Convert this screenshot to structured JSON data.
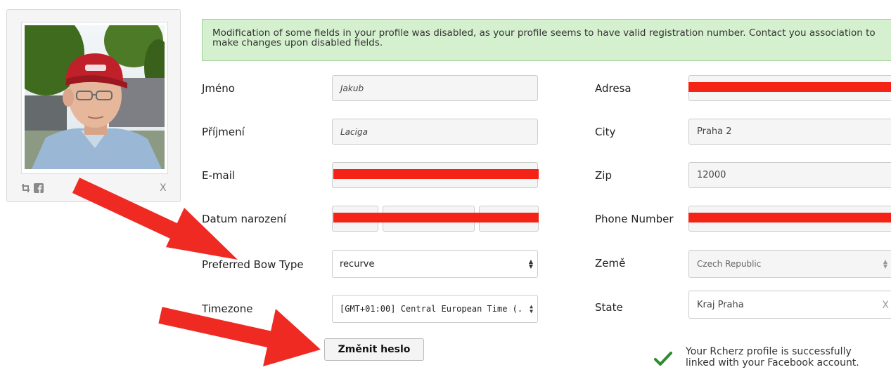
{
  "profile_card": {
    "icons": [
      "crop-icon",
      "facebook-icon",
      "remove-x-icon"
    ],
    "remove_label": "X"
  },
  "notice": {
    "text": "Modification of some fields in your profile was disabled, as your profile seems to have valid registration number. Contact you association to make changes upon disabled fields."
  },
  "left_form": {
    "first_name": {
      "label": "Jméno",
      "value": "Jakub"
    },
    "last_name": {
      "label": "Příjmení",
      "value": "Laciga"
    },
    "email": {
      "label": "E-mail",
      "value": ""
    },
    "birth_date": {
      "label": "Datum narození"
    },
    "bow_type": {
      "label": "Preferred Bow Type",
      "value": "recurve"
    },
    "timezone": {
      "label": "Timezone",
      "value": "[GMT+01:00] Central European Time (."
    }
  },
  "right_form": {
    "address": {
      "label": "Adresa",
      "value": ""
    },
    "city": {
      "label": "City",
      "value": "Praha 2"
    },
    "zip": {
      "label": "Zip",
      "value": "12000"
    },
    "phone": {
      "label": "Phone Number",
      "value": ""
    },
    "country": {
      "label": "Země",
      "value": "Czech Republic"
    },
    "state": {
      "label": "State",
      "value": "Kraj Praha",
      "clear_label": "X"
    }
  },
  "change_password_button": "Změnit heslo",
  "facebook_status": {
    "line1": "Your Rcherz profile is successfully",
    "line2": "linked with your Facebook account."
  },
  "colors": {
    "notice_bg": "#d4f0ce",
    "redaction": "#f52316",
    "arrow": "#ef2a22",
    "check": "#2e8b2e"
  }
}
